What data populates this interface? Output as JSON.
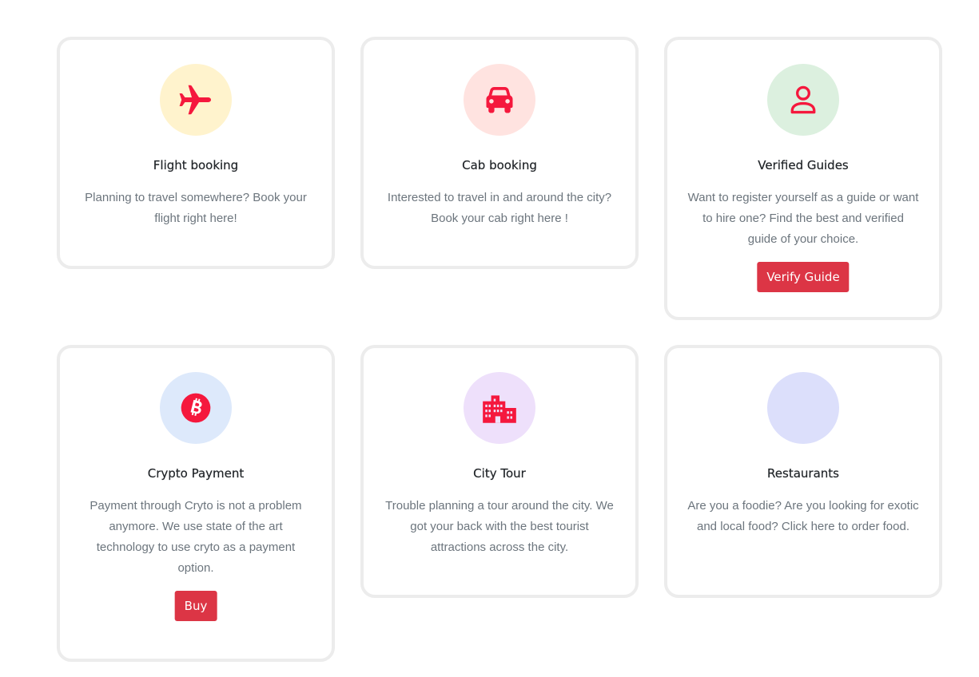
{
  "colors": {
    "icon": "#f5183d",
    "button": "#dc3545",
    "title": "#212529",
    "text": "#6c757d",
    "card_border": "#ececec"
  },
  "cards": [
    {
      "title": "Flight booking",
      "text": "Planning to travel somewhere? Book your flight right here!",
      "icon": "airplane-icon",
      "icon_bg": "#fff3cd"
    },
    {
      "title": "Cab booking",
      "text": "Interested to travel in and around the city? Book your cab right here !",
      "icon": "car-icon",
      "icon_bg": "#ffe3e0"
    },
    {
      "title": "Verified Guides",
      "text": "Want to register yourself as a guide or want to hire one? Find the best and verified guide of your choice.",
      "icon": "person-icon",
      "icon_bg": "#dcf0df",
      "button": "Verify Guide"
    },
    {
      "title": "Crypto Payment",
      "text": "Payment through Cryto is not a problem anymore. We use state of the art technology to use cryto as a payment option.",
      "icon": "bitcoin-icon",
      "icon_bg": "#dde9fb",
      "button": "Buy"
    },
    {
      "title": "City Tour",
      "text": "Trouble planning a tour around the city. We got your back with the best tourist attractions across the city.",
      "icon": "building-icon",
      "icon_bg": "#eee0fb",
      "button": ""
    },
    {
      "title": "Restaurants",
      "text": "Are you a foodie? Are you looking for exotic and local food? Click here to order food.",
      "icon": "",
      "icon_bg": "#dcdffb"
    }
  ]
}
